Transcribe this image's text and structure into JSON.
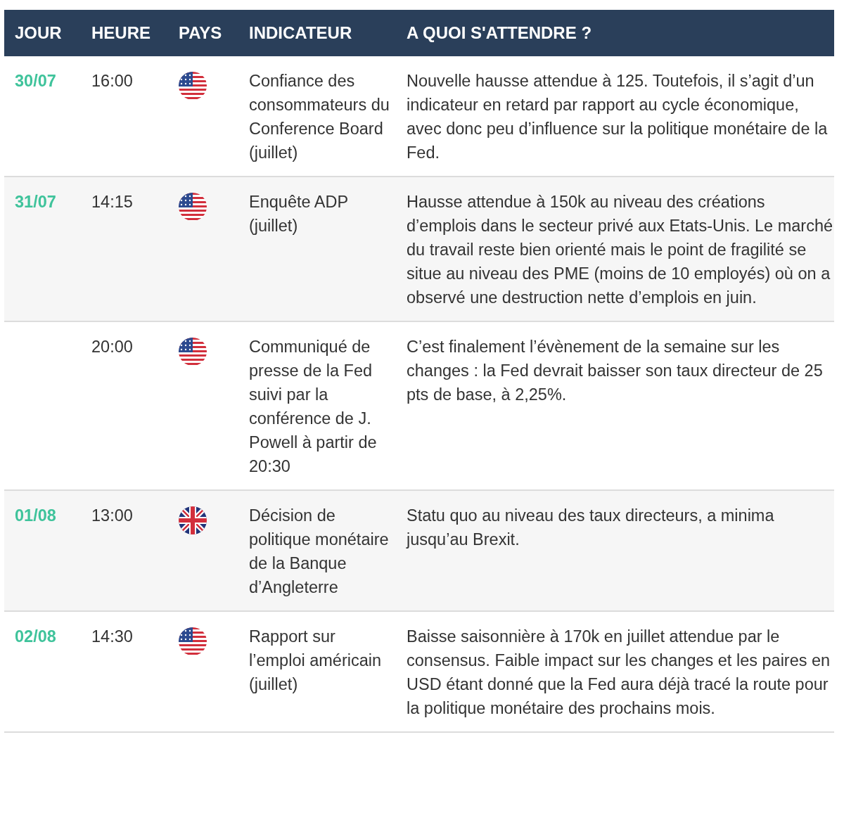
{
  "table": {
    "columns": [
      "JOUR",
      "HEURE",
      "PAYS",
      "INDICATEUR",
      "A QUOI S'ATTENDRE ?"
    ],
    "rows": [
      {
        "day": "30/07",
        "time": "16:00",
        "kind": "us",
        "indicator": "Confiance des consommateurs du Conference Board (juillet)",
        "expectation": "Nouvelle hausse attendue à 125. Toutefois, il s’agit d’un indicateur en retard par rapport au cycle économique, avec donc peu d’influence sur la politique monétaire de la Fed."
      },
      {
        "day": "31/07",
        "time": "14:15",
        "kind": "us",
        "indicator": "Enquête ADP (juillet)",
        "expectation": "Hausse attendue à 150k au niveau des créations d’emplois dans le secteur privé aux Etats-Unis. Le marché du travail reste bien orienté mais le point de fragilité se situe au niveau des PME (moins de 10 employés) où on a observé une destruction nette d’emplois en juin."
      },
      {
        "time": "20:00",
        "kind": "us",
        "indicator": "Communiqué de presse de la Fed suivi par la conférence de J. Powell à partir de 20:30",
        "expectation": "C’est finalement l’évènement de la semaine sur les changes : la Fed devrait baisser son taux directeur de 25 pts de base, à 2,25%."
      },
      {
        "day": "01/08",
        "time": "13:00",
        "kind": "uk",
        "indicator": "Décision de politique monétaire de la Banque d’Angleterre",
        "expectation": "Statu quo au niveau des taux directeurs, a minima jusqu’au Brexit."
      },
      {
        "day": "02/08",
        "time": "14:30",
        "kind": "us",
        "indicator": "Rapport sur l’emploi américain (juillet)",
        "expectation": "Baisse saisonnière à 170k en juillet attendue par le consensus. Faible impact sur les changes et les paires en USD étant donné que la Fed aura déjà tracé la route pour la politique monétaire des prochains mois."
      }
    ]
  }
}
